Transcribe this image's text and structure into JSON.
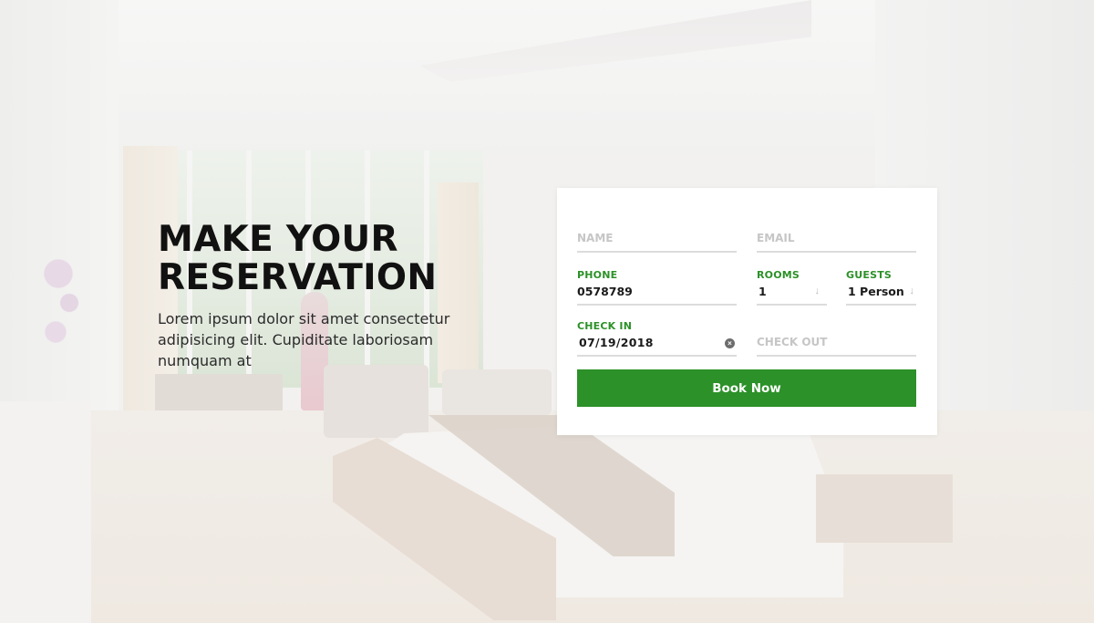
{
  "hero": {
    "title_line1": "MAKE YOUR",
    "title_line2": "RESERVATION",
    "description": "Lorem ipsum dolor sit amet consectetur adipisicing elit. Cupiditate laboriosam numquam at"
  },
  "form": {
    "name": {
      "placeholder": "NAME"
    },
    "email": {
      "placeholder": "EMAIL"
    },
    "phone": {
      "label": "PHONE",
      "value": "0578789"
    },
    "rooms": {
      "label": "ROOMS",
      "value": "1"
    },
    "guests": {
      "label": "GUESTS",
      "value": "1 Person"
    },
    "check_in": {
      "label": "CHECK IN",
      "value": "07/19/2018"
    },
    "check_out": {
      "placeholder": "CHECK OUT"
    },
    "submit_label": "Book Now"
  },
  "icons": {
    "dropdown": "arrow-down-icon",
    "clear": "clear-icon"
  },
  "colors": {
    "accent": "#2c9128",
    "heading": "#111111",
    "card_background": "#ffffff"
  }
}
